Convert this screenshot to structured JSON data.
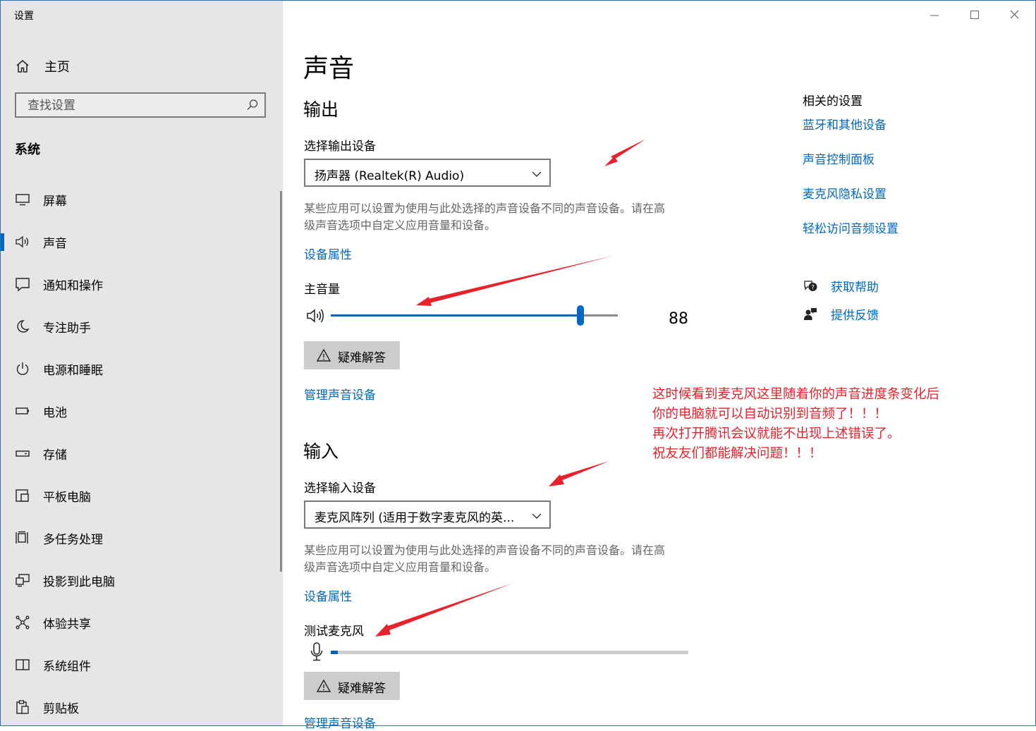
{
  "window": {
    "title": "设置",
    "minimize_icon": "minimize-icon",
    "maximize_icon": "maximize-icon",
    "close_icon": "close-icon"
  },
  "sidebar": {
    "home": {
      "label": "主页",
      "icon": "home-icon"
    },
    "search": {
      "placeholder": "查找设置",
      "icon": "search-icon"
    },
    "section": "系统",
    "items": [
      {
        "label": "屏幕",
        "icon": "display-icon"
      },
      {
        "label": "声音",
        "icon": "speaker-icon",
        "active": true
      },
      {
        "label": "通知和操作",
        "icon": "notification-icon"
      },
      {
        "label": "专注助手",
        "icon": "moon-icon"
      },
      {
        "label": "电源和睡眠",
        "icon": "power-icon"
      },
      {
        "label": "电池",
        "icon": "battery-icon"
      },
      {
        "label": "存储",
        "icon": "storage-icon"
      },
      {
        "label": "平板电脑",
        "icon": "tablet-icon"
      },
      {
        "label": "多任务处理",
        "icon": "multitask-icon"
      },
      {
        "label": "投影到此电脑",
        "icon": "project-icon"
      },
      {
        "label": "体验共享",
        "icon": "share-icon"
      },
      {
        "label": "系统组件",
        "icon": "components-icon"
      },
      {
        "label": "剪贴板",
        "icon": "clipboard-icon"
      }
    ]
  },
  "main": {
    "title": "声音",
    "output": {
      "heading": "输出",
      "select_label": "选择输出设备",
      "device": "扬声器 (Realtek(R) Audio)",
      "description_line1": "某些应用可以设置为使用与此处选择的声音设备不同的声音设备。请在高",
      "description_line2": "级声音选项中自定义应用音量和设备。",
      "properties_link": "设备属性",
      "volume_label": "主音量",
      "volume_value": "88",
      "volume_level": 0.87,
      "troubleshoot": "疑难解答",
      "manage_link": "管理声音设备"
    },
    "input": {
      "heading": "输入",
      "select_label": "选择输入设备",
      "device": "麦克风阵列 (适用于数字麦克风的英...",
      "description_line1": "某些应用可以设置为使用与此处选择的声音设备不同的声音设备。请在高",
      "description_line2": "级声音选项中自定义应用音量和设备。",
      "properties_link": "设备属性",
      "test_label": "测试麦克风",
      "mic_level": 0.02,
      "troubleshoot": "疑难解答",
      "manage_link": "管理声音设备"
    }
  },
  "related": {
    "title": "相关的设置",
    "links": [
      "蓝牙和其他设备",
      "声音控制面板",
      "麦克风隐私设置",
      "轻松访问音频设置"
    ],
    "help": "获取帮助",
    "feedback": "提供反馈"
  },
  "annotation": {
    "lines": [
      "这时候看到麦克风这里随着你的声音进度条变化后",
      "你的电脑就可以自动识别到音频了！！！",
      "再次打开腾讯会议就能不出现上述错误了。",
      "祝友友们都能解决问题！！！"
    ],
    "color": "#e8212a"
  },
  "colors": {
    "accent": "#0067c0",
    "sidebar_bg": "#e6e6e6"
  }
}
